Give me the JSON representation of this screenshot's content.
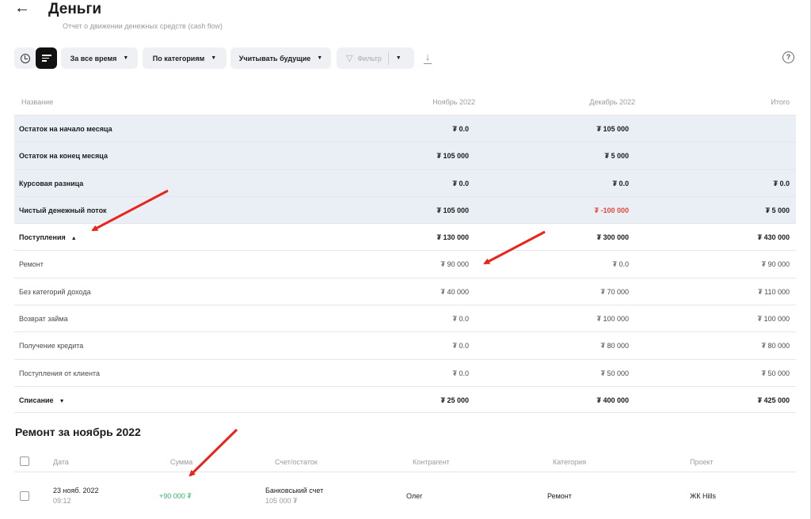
{
  "header": {
    "back_icon": "arrow-left-icon",
    "title": "Деньги",
    "subtitle": "Отчет о движении денежных средств (cash flow)"
  },
  "toolbar": {
    "history_icon": "clock-icon",
    "report_icon": "list-icon",
    "period": "За все время",
    "grouping": "По категориям",
    "future": "Учитывать будущие",
    "filter": "Фильтр",
    "download_icon": "download-icon",
    "help": "?"
  },
  "table": {
    "headers": {
      "name": "Название",
      "col1": "Ноябрь 2022",
      "col2": "Декабрь 2022",
      "col3": "Итого"
    },
    "rows": [
      {
        "name": "Остаток на начало месяца",
        "c1": "₮ 0.0",
        "c2": "₮ 105 000",
        "c3": ""
      },
      {
        "name": "Остаток на конец месяца",
        "c1": "₮ 105 000",
        "c2": "₮ 5 000",
        "c3": ""
      },
      {
        "name": "Курсовая разница",
        "c1": "₮ 0.0",
        "c2": "₮ 0.0",
        "c3": "₮ 0.0"
      },
      {
        "name": "Чистый денежный поток",
        "c1": "₮ 105 000",
        "c2": "₮ -100 000",
        "c3": "₮ 5 000"
      },
      {
        "name": "Поступления",
        "c1": "₮ 130 000",
        "c2": "₮ 300 000",
        "c3": "₮ 430 000",
        "toggle": "▲"
      },
      {
        "name": "Ремонт",
        "c1": "₮ 90 000",
        "c2": "₮ 0.0",
        "c3": "₮ 90 000"
      },
      {
        "name": "Без категорий дохода",
        "c1": "₮ 40 000",
        "c2": "₮ 70 000",
        "c3": "₮ 110 000"
      },
      {
        "name": "Возврат займа",
        "c1": "₮ 0.0",
        "c2": "₮ 100 000",
        "c3": "₮ 100 000"
      },
      {
        "name": "Получение кредита",
        "c1": "₮ 0.0",
        "c2": "₮ 80 000",
        "c3": "₮ 80 000"
      },
      {
        "name": "Поступления от клиента",
        "c1": "₮ 0.0",
        "c2": "₮ 50 000",
        "c3": "₮ 50 000"
      },
      {
        "name": "Списание",
        "c1": "₮ 25 000",
        "c2": "₮ 400 000",
        "c3": "₮ 425 000",
        "toggle": "▼"
      }
    ],
    "colors": {
      "shaded": "#e9eff4",
      "negative": "#e8473d"
    }
  },
  "detail": {
    "title": "Ремонт за ноябрь 2022",
    "headers": {
      "date": "Дата",
      "amount": "Сумма",
      "account": "Счет/остаток",
      "counterparty": "Контрагент",
      "category": "Категория",
      "project": "Проект"
    },
    "rows": [
      {
        "date": "23 нояб. 2022",
        "time": "09:12",
        "amount": "+90 000 ₮",
        "account": "Банковський счет",
        "balance": "105 000 ₮",
        "counterparty": "Олег",
        "category": "Ремонт",
        "project": "ЖК Hills"
      }
    ],
    "colors": {
      "positive": "#2fb26a",
      "annotation_arrow": "#e8241b"
    }
  }
}
